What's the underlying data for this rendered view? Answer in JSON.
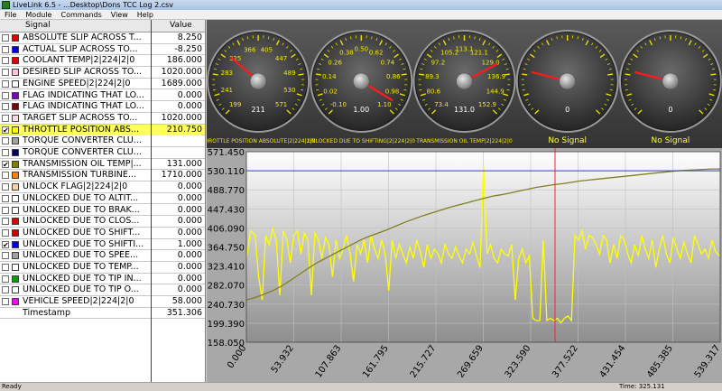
{
  "window": {
    "title": "LiveLink 6.5 - ...Desktop\\Dons TCC Log 2.csv"
  },
  "menu": [
    "File",
    "Module",
    "Commands",
    "View",
    "Help"
  ],
  "table": {
    "header_signal": "Signal",
    "header_value": "Value",
    "rows": [
      {
        "name": "ABSOLUTE SLIP ACROSS T...",
        "value": "8.250",
        "color": "#e00000",
        "checked": false
      },
      {
        "name": "ACTUAL SLIP ACROSS TO...",
        "value": "-8.250",
        "color": "#0000e0",
        "checked": false
      },
      {
        "name": "COOLANT TEMP|2|224|2|0",
        "value": "186.000",
        "color": "#e00000",
        "checked": false
      },
      {
        "name": "DESIRED SLIP ACROSS TO...",
        "value": "1020.000",
        "color": "#ffc0e0",
        "checked": false
      },
      {
        "name": "ENGINE SPEED|2|224|2|0",
        "value": "1689.000",
        "color": "#ffffff",
        "checked": false
      },
      {
        "name": "FLAG INDICATING THAT LO...",
        "value": "0.000",
        "color": "#8000c0",
        "checked": false
      },
      {
        "name": "FLAG INDICATING THAT LO...",
        "value": "0.000",
        "color": "#800000",
        "checked": false
      },
      {
        "name": "TARGET SLIP ACROSS TO...",
        "value": "1020.000",
        "color": "#ffd8e8",
        "checked": false
      },
      {
        "name": "THROTTLE POSITION ABS...",
        "value": "210.750",
        "color": "#ffff00",
        "checked": true,
        "highlight": true
      },
      {
        "name": "TORQUE CONVERTER CLU...",
        "value": "",
        "color": "#a0a0a0",
        "checked": false
      },
      {
        "name": "TORQUE CONVERTER CLU...",
        "value": "",
        "color": "#000060",
        "checked": false
      },
      {
        "name": "TRANSMISSION OIL TEMP|...",
        "value": "131.000",
        "color": "#808000",
        "checked": true
      },
      {
        "name": "TRANSMISSION TURBINE...",
        "value": "1710.000",
        "color": "#ff8000",
        "checked": false
      },
      {
        "name": "UNLOCK FLAG|2|224|2|0",
        "value": "0.000",
        "color": "#ffd0a0",
        "checked": false
      },
      {
        "name": "UNLOCKED DUE TO ALTIT...",
        "value": "0.000",
        "color": "#ffffff",
        "checked": false
      },
      {
        "name": "UNLOCKED DUE TO BRAK...",
        "value": "0.000",
        "color": "#ffffff",
        "checked": false
      },
      {
        "name": "UNLOCKED DUE TO CLOS...",
        "value": "0.000",
        "color": "#e00000",
        "checked": false
      },
      {
        "name": "UNLOCKED DUE TO SHIFT...",
        "value": "0.000",
        "color": "#d00000",
        "checked": false
      },
      {
        "name": "UNLOCKED DUE TO SHIFTI...",
        "value": "1.000",
        "color": "#0000e0",
        "checked": true
      },
      {
        "name": "UNLOCKED DUE TO SPEE...",
        "value": "0.000",
        "color": "#a0a0a0",
        "checked": false
      },
      {
        "name": "UNLOCKED DUE TO TEMP...",
        "value": "0.000",
        "color": "#ffffff",
        "checked": false
      },
      {
        "name": "UNLOCKED DUE TO TIP IN...",
        "value": "0.000",
        "color": "#00a000",
        "checked": false
      },
      {
        "name": "UNLOCKED DUE TO TIP O...",
        "value": "0.000",
        "color": "#ffffff",
        "checked": false
      },
      {
        "name": "VEHICLE SPEED|2|224|2|0",
        "value": "58.000",
        "color": "#ff00ff",
        "checked": false
      }
    ],
    "timestamp_label": "Timestamp",
    "timestamp_value": "351.306"
  },
  "gauges": [
    {
      "label": "THROTTLE POSITION ABSOLUTE|2|224|2|0",
      "center_value": "211",
      "ticks": [
        "199",
        "241",
        "283",
        "325",
        "366",
        "405",
        "447",
        "489",
        "530",
        "571"
      ],
      "value": 0.32,
      "no_signal": false
    },
    {
      "label": "UNLOCKED DUE TO SHIFTING|2|224|2|0",
      "center_value": "1.00",
      "ticks": [
        "-0.10",
        "0.02",
        "0.14",
        "0.26",
        "0.38",
        "0.50",
        "0.62",
        "0.74",
        "0.86",
        "0.98",
        "1.10"
      ],
      "value": 0.95,
      "no_signal": false
    },
    {
      "label": "TRANSMISSION OIL TEMP|2|224|2|0",
      "center_value": "131.0",
      "ticks": [
        "73.4",
        "80.6",
        "89.3",
        "97.2",
        "105.2",
        "113.1",
        "121.1",
        "129.0",
        "136.9",
        "144.9",
        "152.9"
      ],
      "value": 0.73,
      "no_signal": false
    },
    {
      "label": "No Signal",
      "center_value": "0",
      "ticks": [],
      "value": 0.22,
      "no_signal": true
    },
    {
      "label": "No Signal",
      "center_value": "0",
      "ticks": [],
      "value": 0.22,
      "no_signal": true
    }
  ],
  "chart_data": {
    "type": "line",
    "yticks": [
      "158.050",
      "199.390",
      "240.730",
      "282.070",
      "323.410",
      "364.750",
      "406.090",
      "447.430",
      "488.770",
      "530.110",
      "571.450"
    ],
    "ylim": [
      158.05,
      571.45
    ],
    "xticks": [
      "0.000",
      "53.932",
      "107.863",
      "161.795",
      "215.727",
      "269.659",
      "323.590",
      "377.522",
      "431.454",
      "485.385",
      "539.317"
    ],
    "xlim": [
      0,
      539.317
    ],
    "reference_line_y": 530.11,
    "cursor_x": 351.306,
    "series": [
      {
        "color": "#ffff00",
        "x": [
          0,
          5,
          10,
          14,
          18,
          22,
          26,
          30,
          34,
          38,
          42,
          46,
          50,
          54,
          58,
          62,
          66,
          70,
          74,
          78,
          82,
          86,
          90,
          94,
          98,
          102,
          106,
          110,
          114,
          118,
          122,
          126,
          130,
          134,
          138,
          142,
          146,
          150,
          154,
          158,
          162,
          166,
          170,
          174,
          178,
          182,
          186,
          190,
          194,
          198,
          202,
          206,
          210,
          214,
          218,
          222,
          226,
          230,
          234,
          238,
          242,
          246,
          250,
          254,
          258,
          262,
          266,
          270,
          274,
          278,
          282,
          286,
          290,
          294,
          298,
          302,
          306,
          310,
          314,
          318,
          322,
          326,
          330,
          334,
          338,
          342,
          346,
          350,
          354,
          358,
          362,
          366,
          370,
          374,
          378,
          382,
          386,
          390,
          394,
          398,
          402,
          406,
          410,
          414,
          418,
          422,
          426,
          430,
          434,
          438,
          442,
          446,
          450,
          454,
          458,
          462,
          466,
          470,
          474,
          478,
          482,
          486,
          490,
          494,
          498,
          502,
          506,
          510,
          514,
          518,
          522,
          526,
          530,
          534,
          539
        ],
        "y": [
          340,
          400,
          390,
          300,
          250,
          390,
          370,
          405,
          380,
          260,
          400,
          380,
          330,
          390,
          400,
          350,
          395,
          380,
          260,
          395,
          380,
          340,
          385,
          370,
          300,
          380,
          340,
          360,
          390,
          350,
          290,
          370,
          350,
          380,
          330,
          390,
          360,
          340,
          380,
          350,
          270,
          380,
          340,
          370,
          350,
          330,
          365,
          340,
          380,
          355,
          320,
          370,
          340,
          360,
          350,
          330,
          370,
          350,
          340,
          365,
          345,
          330,
          360,
          350,
          375,
          345,
          320,
          540,
          350,
          370,
          340,
          330,
          360,
          350,
          345,
          370,
          250,
          340,
          360,
          330,
          345,
          210,
          205,
          205,
          380,
          205,
          210,
          205,
          210,
          200,
          210,
          215,
          205,
          390,
          380,
          400,
          360,
          390,
          385,
          370,
          350,
          390,
          380,
          330,
          370,
          340,
          390,
          380,
          350,
          330,
          370,
          345,
          390,
          360,
          340,
          380,
          320,
          360,
          390,
          350,
          330,
          385,
          360,
          340,
          375,
          350,
          330,
          390,
          370,
          350,
          360,
          340,
          380,
          355,
          345
        ]
      },
      {
        "color": "#808020",
        "x": [
          0,
          10,
          20,
          30,
          40,
          50,
          60,
          70,
          80,
          90,
          100,
          110,
          120,
          130,
          140,
          150,
          160,
          170,
          180,
          190,
          200,
          210,
          220,
          230,
          240,
          250,
          260,
          270,
          280,
          290,
          300,
          310,
          320,
          330,
          340,
          350,
          360,
          370,
          380,
          390,
          400,
          410,
          420,
          430,
          440,
          450,
          460,
          470,
          480,
          490,
          500,
          510,
          520,
          530,
          539
        ],
        "y": [
          250,
          255,
          262,
          270,
          280,
          292,
          305,
          318,
          330,
          340,
          350,
          360,
          370,
          380,
          388,
          395,
          402,
          410,
          418,
          425,
          432,
          438,
          444,
          450,
          455,
          460,
          465,
          470,
          475,
          478,
          482,
          486,
          490,
          494,
          497,
          500,
          502,
          505,
          508,
          510,
          512,
          514,
          516,
          518,
          520,
          522,
          524,
          526,
          528,
          530,
          531,
          532,
          533,
          534,
          534
        ]
      }
    ]
  }
}
